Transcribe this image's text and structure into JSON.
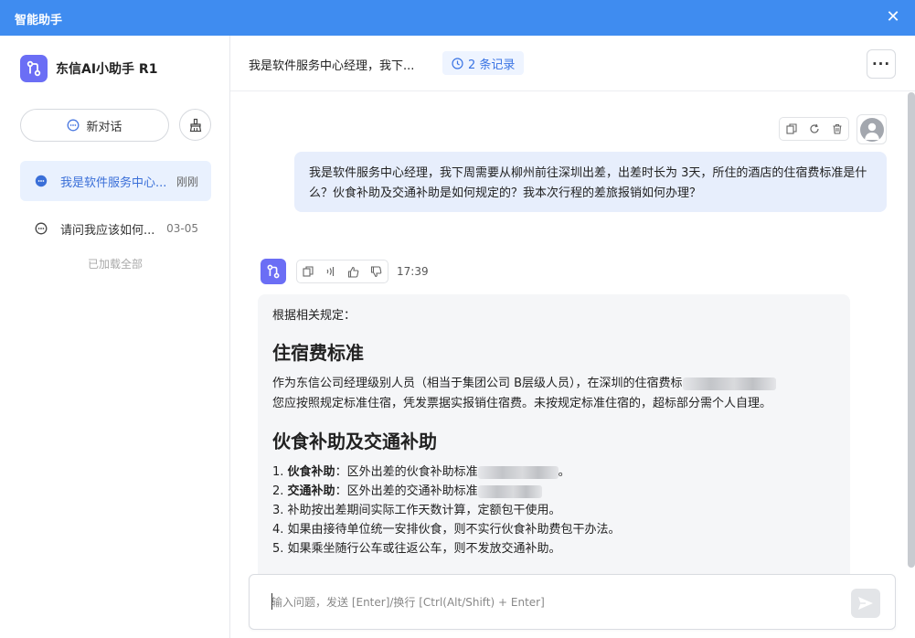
{
  "window": {
    "title": "智能助手",
    "close_icon": "close-icon"
  },
  "colors": {
    "titlebar": "#3f8cf0",
    "brand": "#6b6ef5",
    "accent": "#3a6fd8",
    "user_bubble": "#e7eefc",
    "bot_bubble": "#f5f6f8"
  },
  "sidebar": {
    "brand_name": "东信AI小助手 R1",
    "new_chat_label": "新对话",
    "conversations": [
      {
        "label": "我是软件服务中心...",
        "time": "刚刚",
        "active": true
      },
      {
        "label": "请问我应该如何...",
        "time": "03-05",
        "active": false
      }
    ],
    "loaded_all": "已加载全部"
  },
  "header": {
    "title": "我是软件服务中心经理，我下...",
    "records": "2 条记录",
    "more": "···"
  },
  "chat": {
    "user_message": "我是软件服务中心经理，我下周需要从柳州前往深圳出差，出差时长为 3天，所住的酒店的住宿费标准是什么？伙食补助及交通补助是如何规定的？我本次行程的差旅报销如何办理？",
    "bot_time": "17:39",
    "bot": {
      "intro": "根据相关规定：",
      "h1": "住宿费标准",
      "p1a": "作为东信公司经理级别人员（相当于集团公司 B层级人员），在深圳的住宿费标",
      "p1b": "您应按照规定标准住宿，凭发票据实报销住宿费。未按规定标准住宿的，超标部分需个人自理。",
      "h2": "伙食补助及交通补助",
      "list": [
        {
          "num": "1.",
          "bold": "伙食补助",
          "text": "：区外出差的伙食补助标准",
          "tail": "。"
        },
        {
          "num": "2.",
          "bold": "交通补助",
          "text": "：区外出差的交通补助标准",
          "tail": ""
        },
        {
          "num": "3.",
          "bold": "",
          "text": "补助按出差期间实际工作天数计算，定额包干使用。",
          "tail": ""
        },
        {
          "num": "4.",
          "bold": "",
          "text": "如果由接待单位统一安排伙食，则不实行伙食补助费包干办法。",
          "tail": ""
        },
        {
          "num": "5.",
          "bold": "",
          "text": "如果乘坐随行公车或往返公车，则不发放交通补助。",
          "tail": ""
        }
      ]
    }
  },
  "input": {
    "placeholder": "输入问题，发送 [Enter]/换行 [Ctrl(Alt/Shift) + Enter]",
    "value": ""
  }
}
